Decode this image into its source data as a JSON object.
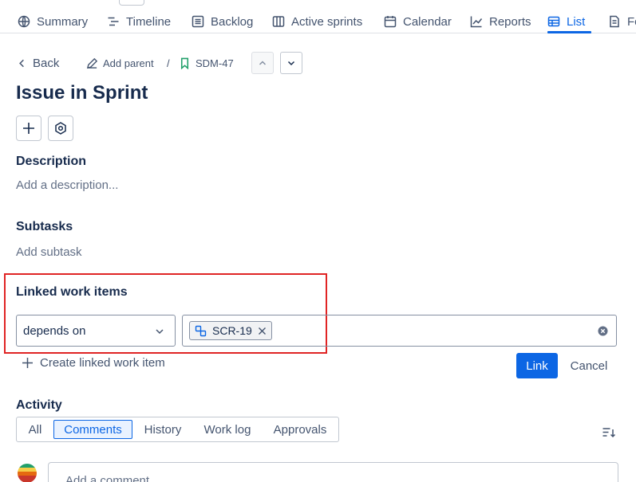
{
  "nav": {
    "tabs": [
      {
        "label": "Summary",
        "icon": "globe-icon"
      },
      {
        "label": "Timeline",
        "icon": "timeline-icon"
      },
      {
        "label": "Backlog",
        "icon": "backlog-icon"
      },
      {
        "label": "Active sprints",
        "icon": "board-icon"
      },
      {
        "label": "Calendar",
        "icon": "calendar-icon"
      },
      {
        "label": "Reports",
        "icon": "chart-line-icon"
      },
      {
        "label": "List",
        "icon": "list-table-icon",
        "active": true
      },
      {
        "label": "Fo",
        "icon": "form-icon"
      }
    ]
  },
  "breadcrumb": {
    "back_label": "Back",
    "add_parent_label": "Add parent",
    "separator": "/",
    "issue_key": "SDM-47"
  },
  "issue": {
    "title": "Issue in Sprint"
  },
  "description": {
    "heading": "Description",
    "placeholder": "Add a description..."
  },
  "subtasks": {
    "heading": "Subtasks",
    "add_label": "Add subtask"
  },
  "linked_items": {
    "heading": "Linked work items",
    "relation_value": "depends on",
    "selected_tag": "SCR-19",
    "create_label": "Create linked work item",
    "link_button": "Link",
    "cancel_button": "Cancel"
  },
  "activity": {
    "heading": "Activity",
    "filters": [
      "All",
      "Comments",
      "History",
      "Work log",
      "Approvals"
    ],
    "active_filter": "Comments",
    "comment_placeholder": "Add a comment..."
  },
  "colors": {
    "accent": "#0c66e4",
    "highlight": "#e02424",
    "text": "#172b4d",
    "subtle_text": "#44546f"
  }
}
